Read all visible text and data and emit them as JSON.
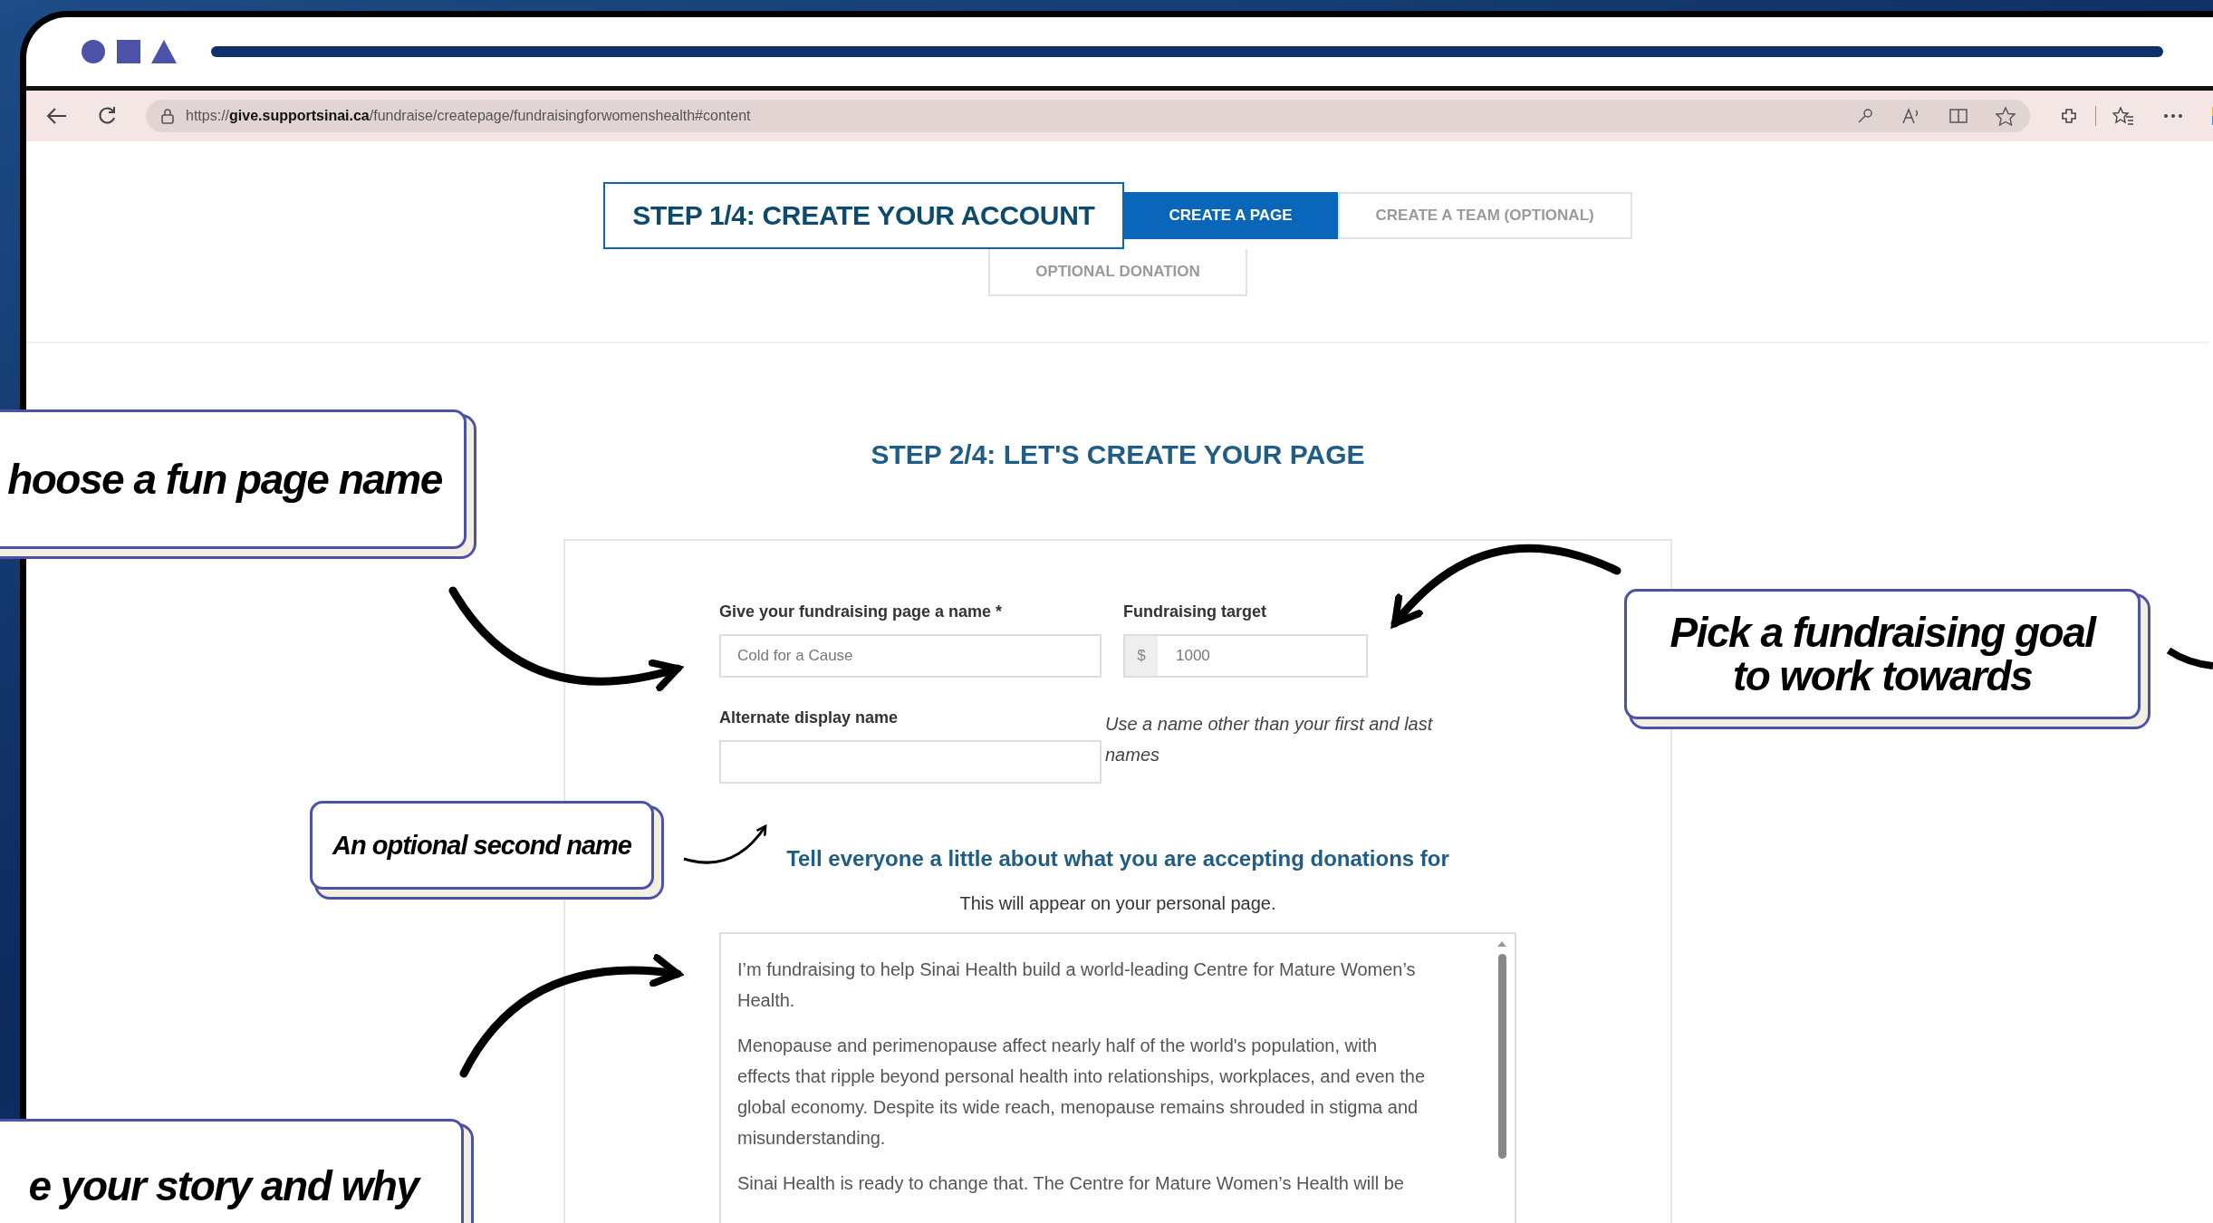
{
  "browser": {
    "url": "https://**give.supportsinai.ca**/fundraise/createpage/fundraisingforwomenshealth#content"
  },
  "step_1": {
    "title": "STEP 1/4: CREATE YOUR ACCOUNT",
    "tabs": [
      {
        "label": "CREATE A PAGE",
        "selected": true
      },
      {
        "label": "CREATE A TEAM (OPTIONAL)",
        "selected": false
      },
      {
        "label": "OPTIONAL DONATION",
        "selected": false
      }
    ]
  },
  "step_2": {
    "title": "STEP 2/4: LET'S CREATE YOUR PAGE",
    "page_name": {
      "label": "Give your fundraising page a name *",
      "value": "Cold for a Cause"
    },
    "target": {
      "label": "Fundraising target",
      "currency": "$",
      "value": "1000"
    },
    "alternate_name": {
      "label": "Alternate display name",
      "hint": "Use a name other than your first and last names"
    },
    "story_heading": "Tell everyone a little about what you are accepting donations for",
    "story_note": "This will appear on your personal page.",
    "story": [
      "I’m fundraising to help Sinai Health build a world-leading Centre for Mature Women’s Health.",
      "Menopause and perimenopause affect nearly half of the world's population, with effects that ripple beyond personal health into relationships, workplaces, and even the global economy. Despite its wide reach, menopause remains shrouded in stigma and misunderstanding.",
      "Sinai Health is ready to change that. The Centre for Mature Women’s Health will be"
    ]
  },
  "callouts": [
    "hoose a fun page name",
    "An optional second name",
    "Pick a fundraising goal to work towards",
    "e your story and why"
  ]
}
